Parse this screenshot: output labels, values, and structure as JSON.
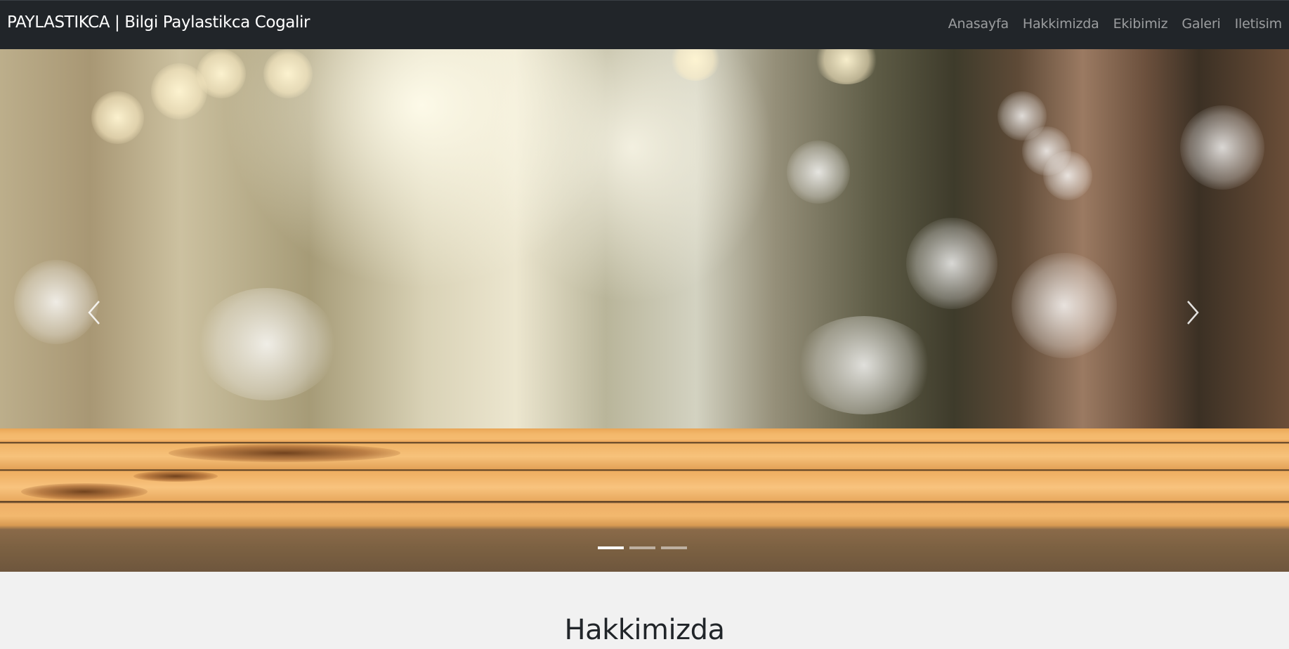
{
  "navbar": {
    "brand": "PAYLASTIKCA | Bilgi Paylastikca Cogalir",
    "links": [
      "Anasayfa",
      "Hakkimizda",
      "Ekibimiz",
      "Galeri",
      "Iletisim"
    ]
  },
  "carousel": {
    "prev_icon": "chevron-left-icon",
    "next_icon": "chevron-right-icon",
    "indicator_count": 3,
    "active_index": 0
  },
  "about": {
    "heading": "Hakkimizda"
  },
  "colors": {
    "navbar_bg": "#212529",
    "section_bg": "#f1f1f1"
  }
}
